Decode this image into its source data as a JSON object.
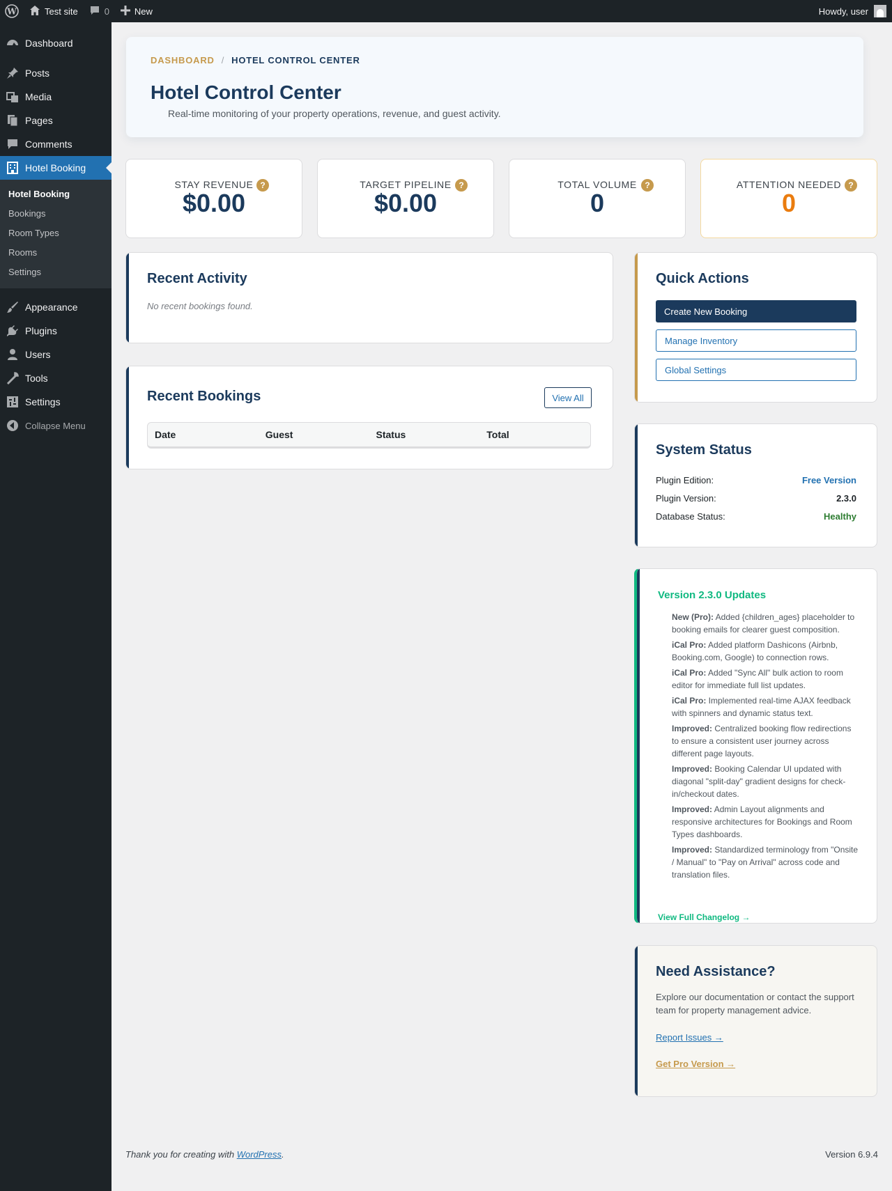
{
  "adminbar": {
    "site_name": "Test site",
    "comments_count": "0",
    "new_label": "New",
    "howdy": "Howdy, user"
  },
  "sidebar": {
    "items_top": [
      {
        "label": "Dashboard",
        "icon": "dashboard-icon"
      },
      {
        "label": "Posts",
        "icon": "pin-icon"
      },
      {
        "label": "Media",
        "icon": "media-icon"
      },
      {
        "label": "Pages",
        "icon": "pages-icon"
      },
      {
        "label": "Comments",
        "icon": "comment-icon"
      }
    ],
    "active": {
      "label": "Hotel Booking",
      "icon": "building-icon"
    },
    "submenu": [
      "Hotel Booking",
      "Bookings",
      "Room Types",
      "Rooms",
      "Settings"
    ],
    "items_bottom": [
      {
        "label": "Appearance",
        "icon": "brush-icon"
      },
      {
        "label": "Plugins",
        "icon": "plug-icon"
      },
      {
        "label": "Users",
        "icon": "user-icon"
      },
      {
        "label": "Tools",
        "icon": "wrench-icon"
      },
      {
        "label": "Settings",
        "icon": "settings-icon"
      }
    ],
    "collapse": "Collapse Menu"
  },
  "hero": {
    "crumb_root": "DASHBOARD",
    "crumb_sep": "/",
    "crumb_current": "HOTEL CONTROL CENTER",
    "title": "Hotel Control Center",
    "subtitle": "Real-time monitoring of your property operations, revenue, and guest activity."
  },
  "stats": [
    {
      "label": "STAY REVENUE",
      "value": "$0.00"
    },
    {
      "label": "TARGET PIPELINE",
      "value": "$0.00"
    },
    {
      "label": "TOTAL VOLUME",
      "value": "0"
    },
    {
      "label": "ATTENTION NEEDED",
      "value": "0"
    }
  ],
  "help_glyph": "?",
  "activity": {
    "title": "Recent Activity",
    "empty": "No recent bookings found."
  },
  "bookings": {
    "title": "Recent Bookings",
    "view_all": "View All",
    "columns": [
      "Date",
      "Guest",
      "Status",
      "Total"
    ]
  },
  "quick_actions": {
    "title": "Quick Actions",
    "create": "Create New Booking",
    "inventory": "Manage Inventory",
    "settings": "Global Settings"
  },
  "system": {
    "title": "System Status",
    "rows": [
      {
        "label": "Plugin Edition:",
        "value": "Free Version",
        "color": "#2271b1"
      },
      {
        "label": "Plugin Version:",
        "value": "2.3.0",
        "color": "#1d2327"
      },
      {
        "label": "Database Status:",
        "value": "Healthy",
        "color": "#2e7d32"
      }
    ]
  },
  "updates": {
    "title": "Version 2.3.0 Updates",
    "items": [
      {
        "tag": "New (Pro):",
        "text": " Added {children_ages} placeholder to booking emails for clearer guest composition."
      },
      {
        "tag": "iCal Pro:",
        "text": " Added platform Dashicons (Airbnb, Booking.com, Google) to connection rows."
      },
      {
        "tag": "iCal Pro:",
        "text": " Added \"Sync All\" bulk action to room editor for immediate full list updates."
      },
      {
        "tag": "iCal Pro:",
        "text": " Implemented real-time AJAX feedback with spinners and dynamic status text."
      },
      {
        "tag": "Improved:",
        "text": " Centralized booking flow redirections to ensure a consistent user journey across different page layouts."
      },
      {
        "tag": "Improved:",
        "text": " Booking Calendar UI updated with diagonal \"split-day\" gradient designs for check-in/checkout dates."
      },
      {
        "tag": "Improved:",
        "text": " Admin Layout alignments and responsive architectures for Bookings and Room Types dashboards."
      },
      {
        "tag": "Improved:",
        "text": " Standardized terminology from \"Onsite / Manual\" to \"Pay on Arrival\" across code and translation files."
      }
    ],
    "changelog": "View Full Changelog →"
  },
  "assist": {
    "title": "Need Assistance?",
    "text": "Explore our documentation or contact the support team for property management advice.",
    "report": "Report Issues →",
    "pro": "Get Pro Version →"
  },
  "footer": {
    "thanks_prefix": "Thank you for creating with ",
    "link": "WordPress",
    "suffix": ".",
    "version": "Version 6.9.4"
  },
  "colors": {
    "navy": "#1b3a5c",
    "gold": "#c69a4d",
    "wp_blue": "#2271b1",
    "green": "#10b981",
    "orange": "#ea7c0f"
  }
}
